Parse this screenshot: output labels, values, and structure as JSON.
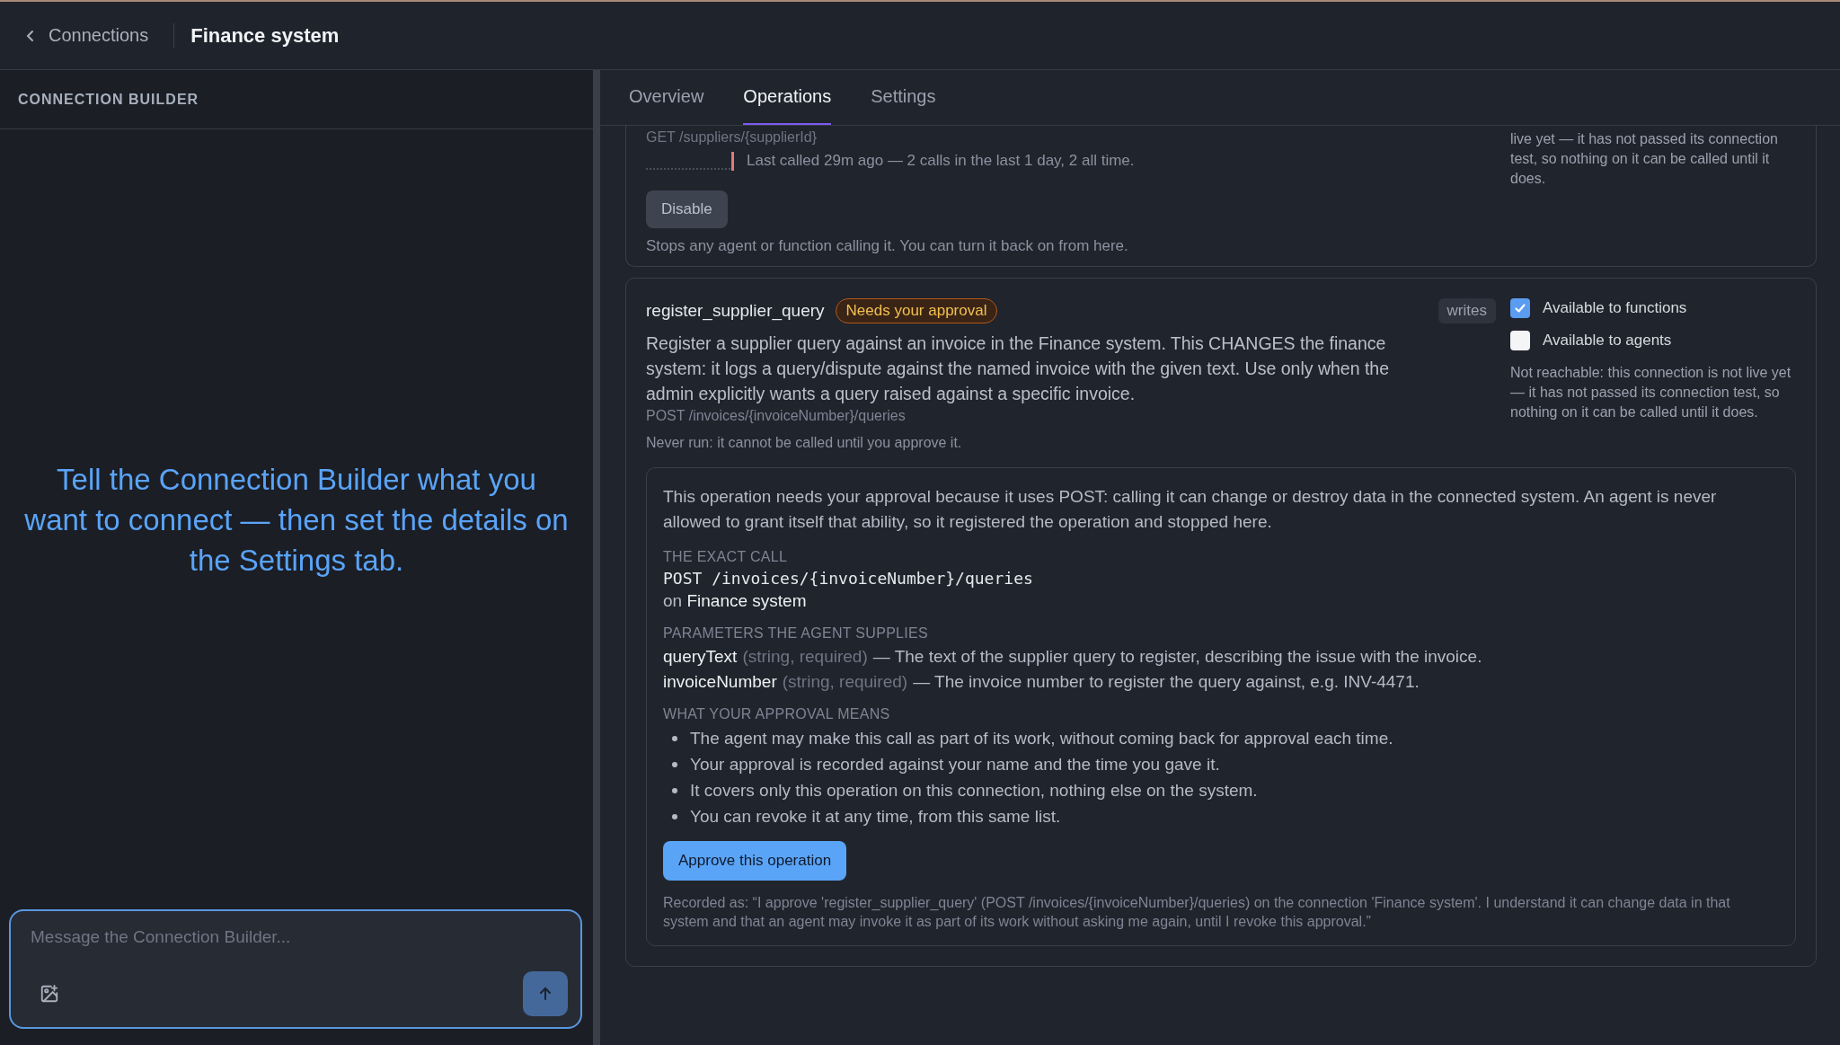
{
  "header": {
    "back_label": "Connections",
    "title": "Finance system"
  },
  "builder": {
    "heading": "CONNECTION BUILDER",
    "prompt": "Tell the Connection Builder what you want to connect — then set the details on the Settings tab.",
    "composer": {
      "placeholder": "Message the Connection Builder..."
    }
  },
  "tabs": [
    {
      "label": "Overview",
      "selected": false
    },
    {
      "label": "Operations",
      "selected": true
    },
    {
      "label": "Settings",
      "selected": false
    }
  ],
  "enabled_operation": {
    "endpoint": "GET /suppliers/{supplierId}",
    "last_called": "Last called 29m ago — 2 calls in the last 1 day, 2 all time.",
    "note": "live yet — it has not passed its connection test, so nothing on it can be called until it does.",
    "action": "Disable",
    "action_note": "Stops any agent or function calling it. You can turn it back on from here."
  },
  "pending_operation": {
    "name": "register_supplier_query",
    "badge": "Needs your approval",
    "access": "writes",
    "description": "Register a supplier query against an invoice in the Finance system. This CHANGES the finance system: it logs a query/dispute against the named invoice with the given text. Use only when the admin explicitly wants a query raised against a specific invoice.",
    "endpoint": "POST /invoices/{invoiceNumber}/queries",
    "run_status": "Never run: it cannot be called until you approve it.",
    "toggles": [
      {
        "label": "Available to functions",
        "checked": true
      },
      {
        "label": "Available to agents",
        "checked": false
      }
    ],
    "note": "Not reachable: this connection is not live yet — it has not passed its connection test, so nothing on it can be called until it does.",
    "approval": {
      "intro": "This operation needs your approval because it uses POST: calling it can change or destroy data in the connected system. An agent is never allowed to grant itself that ability, so it registered the operation and stopped here.",
      "call_heading": "THE EXACT CALL",
      "call": "POST /invoices/{invoiceNumber}/queries",
      "on_label": "on",
      "system": "Finance system",
      "params_heading": "PARAMETERS THE AGENT SUPPLIES",
      "params": [
        {
          "name": "queryText",
          "type": "(string, required)",
          "description": "— The text of the supplier query to register, describing the issue with the invoice."
        },
        {
          "name": "invoiceNumber",
          "type": "(string, required)",
          "description": "— The invoice number to register the query against, e.g. INV-4471."
        }
      ],
      "means_heading": "WHAT YOUR APPROVAL MEANS",
      "means": [
        "The agent may make this call as part of its work, without coming back for approval each time.",
        "Your approval is recorded against your name and the time you gave it.",
        "It covers only this operation on this connection, nothing else on the system.",
        "You can revoke it at any time, from this same list."
      ],
      "button": "Approve this operation",
      "recorded": "Recorded as: “I approve 'register_supplier_query' (POST /invoices/{invoiceNumber}/queries) on the connection 'Finance system'. I understand it can change data in that system and that an agent may invoke it as part of its work without asking me again, until I revoke this approval.”"
    }
  }
}
